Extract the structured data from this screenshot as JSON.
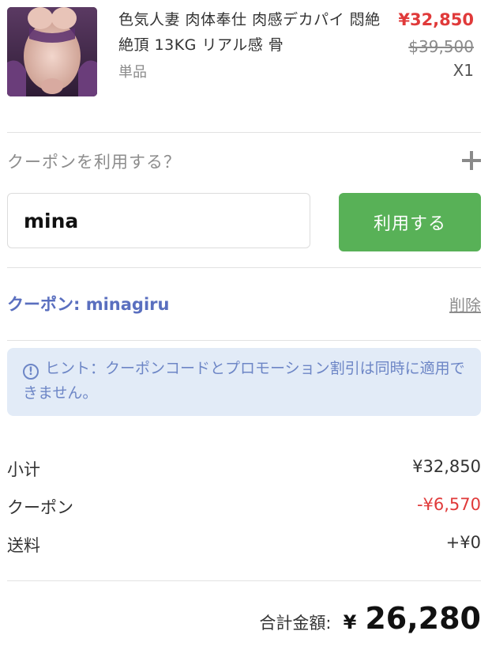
{
  "cart_item": {
    "title": "色気人妻 肉体奉仕 肉感デカパイ 悶絶絶頂 13KG リアル感 骨",
    "variant": "単品",
    "price_sale": "¥32,850",
    "price_original": "$39,500",
    "quantity": "X1"
  },
  "coupon": {
    "toggle_label": "クーポンを利用する？",
    "input_value": "mina",
    "apply_label": "利用する",
    "applied_text": "クーポン: minagiru",
    "remove_label": "削除",
    "hint_text": "ヒント：クーポンコードとプロモーション割引は同時に適用できません。"
  },
  "summary": {
    "subtotal_label": "小计",
    "subtotal_value": "¥32,850",
    "coupon_label": "クーポン",
    "coupon_value": "-¥6,570",
    "shipping_label": "送料",
    "shipping_value": "+¥0",
    "total_label": "合計金額:",
    "total_currency": "¥",
    "total_amount": "26,280"
  },
  "colors": {
    "sale_price": "#e03a3a",
    "apply_button": "#58b157",
    "coupon_text": "#5a6fbf",
    "hint_background": "#e2ebf7"
  }
}
